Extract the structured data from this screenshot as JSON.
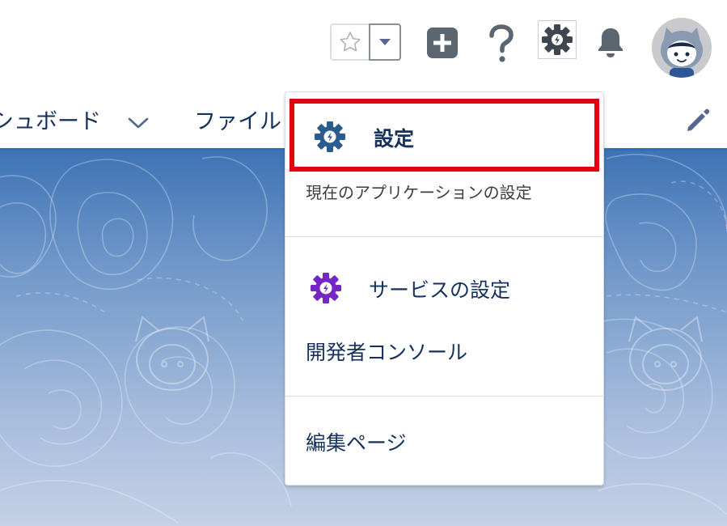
{
  "header": {
    "favorites": {
      "star_icon": "star-outline-icon",
      "dropdown_icon": "caret-down-icon"
    },
    "global_actions_icon": "plus-icon",
    "help_icon": "question-icon",
    "setup_icon": "gear-icon",
    "notifications_icon": "bell-icon",
    "avatar_icon": "astro-avatar"
  },
  "nav": {
    "dashboard_label": "シュボード",
    "files_label": "ファイル",
    "chevron_icon": "chevron-down-icon",
    "edit_icon": "pencil-icon"
  },
  "setup_menu": {
    "setup": {
      "label": "設定",
      "description": "現在のアプリケーションの設定",
      "icon": "gear-bolt-icon",
      "icon_color": "#2a5d8f"
    },
    "service_setup": {
      "label": "サービスの設定",
      "icon": "gear-bolt-icon",
      "icon_color": "#7526c4"
    },
    "developer_console": {
      "label": "開発者コンソール"
    },
    "edit_page": {
      "label": "編集ページ"
    }
  },
  "colors": {
    "highlight": "#e3000f",
    "nav_border": "#2d6eb8",
    "text": "#16325c"
  }
}
